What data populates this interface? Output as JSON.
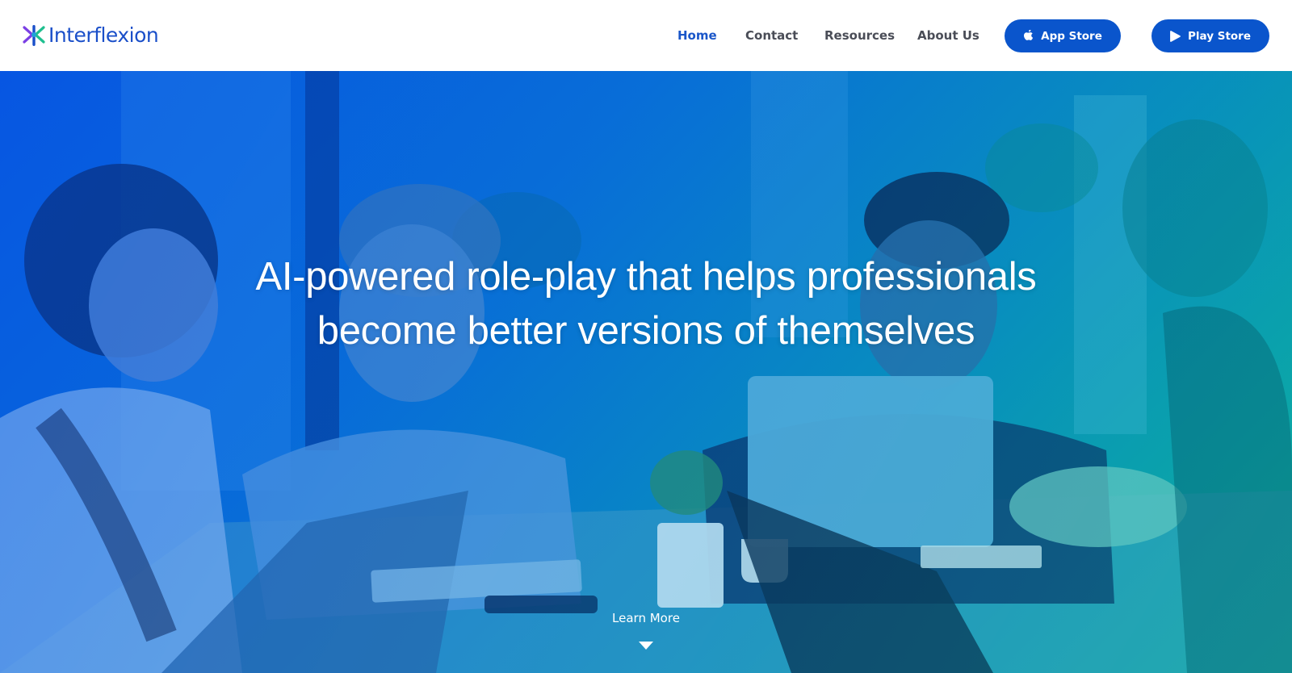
{
  "brand": {
    "name": "Interflexion",
    "color": "#1a4fc9",
    "logo_icon": "interflexion-logo-icon"
  },
  "nav": {
    "items": [
      {
        "label": "Home",
        "active": true
      },
      {
        "label": "Contact",
        "active": false
      },
      {
        "label": "Resources",
        "active": false
      },
      {
        "label": "About Us",
        "active": false
      }
    ],
    "active_color": "#1a56c9",
    "color": "#4a4d57"
  },
  "stores": {
    "app_store": {
      "label": "App Store",
      "icon": "apple-icon"
    },
    "play_store": {
      "label": "Play Store",
      "icon": "play-icon"
    },
    "button_color": "#0a55cc"
  },
  "hero": {
    "title": "AI-powered role-play that helps professionals become better versions of themselves",
    "learn_more": "Learn More",
    "learn_more_icon": "caret-down-icon",
    "tint_start": "#0a5fe0",
    "tint_end": "#13b69a"
  }
}
